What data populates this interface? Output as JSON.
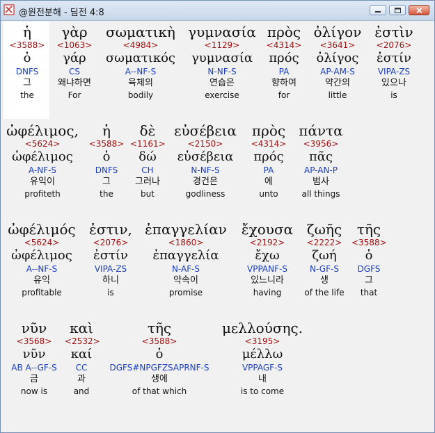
{
  "window": {
    "title": "@원전분해 - 딤전 4:8"
  },
  "colors": {
    "strongs": "#a01010",
    "parsing": "#1a3ebf",
    "text": "#111111"
  },
  "icons": {
    "app": "app-icon",
    "minimize": "minimize-icon",
    "maximize": "maximize-icon",
    "close": "close-icon"
  },
  "rows": [
    {
      "words": [
        {
          "greek": "ἡ",
          "strongs": "<3588>",
          "lemma": "ὁ",
          "parse": "DNFS",
          "korean": "그",
          "english": "the"
        },
        {
          "greek": "γὰρ",
          "strongs": "<1063>",
          "lemma": "γάρ",
          "parse": "CS",
          "korean": "왜냐하면",
          "english": "For"
        },
        {
          "greek": "σωματικὴ",
          "strongs": "<4984>",
          "lemma": "σωματικός",
          "parse": "A--NF-S",
          "korean": "육체의",
          "english": "bodily"
        },
        {
          "greek": "γυμνασία",
          "strongs": "<1129>",
          "lemma": "γυμνασία",
          "parse": "N-NF-S",
          "korean": "연습은",
          "english": "exercise"
        },
        {
          "greek": "πρὸς",
          "strongs": "<4314>",
          "lemma": "πρός",
          "parse": "PA",
          "korean": "향하여",
          "english": "for"
        },
        {
          "greek": "ὀλίγον",
          "strongs": "<3641>",
          "lemma": "ὀλίγος",
          "parse": "AP-AM-S",
          "korean": "약간의",
          "english": "little"
        },
        {
          "greek": "ἐστὶν",
          "strongs": "<2076>",
          "lemma": "ἐστίν",
          "parse": "VIPA-ZS",
          "korean": "있으나",
          "english": "is"
        }
      ]
    },
    {
      "words": [
        {
          "greek": "ὠφέλιμος,",
          "strongs": "<5624>",
          "lemma": "ὠφέλιμος",
          "parse": "A-NF-S",
          "korean": "유익이",
          "english": "profiteth"
        },
        {
          "greek": "ἡ",
          "strongs": "<3588>",
          "lemma": "ὁ",
          "parse": "DNFS",
          "korean": "그",
          "english": "the"
        },
        {
          "greek": "δὲ",
          "strongs": "<1161>",
          "lemma": "δώ",
          "parse": "CH",
          "korean": "그러나",
          "english": "but"
        },
        {
          "greek": "εὐσέβεια",
          "strongs": "<2150>",
          "lemma": "εὐσέβεια",
          "parse": "N-NF-S",
          "korean": "경건은",
          "english": "godliness"
        },
        {
          "greek": "πρὸς",
          "strongs": "<4314>",
          "lemma": "πρός",
          "parse": "PA",
          "korean": "에",
          "english": "unto"
        },
        {
          "greek": "πάντα",
          "strongs": "<3956>",
          "lemma": "πᾶς",
          "parse": "AP-AN-P",
          "korean": "범사",
          "english": "all things"
        }
      ]
    },
    {
      "words": [
        {
          "greek": "ὠφέλιμός",
          "strongs": "<5624>",
          "lemma": "ὠφέλιμος",
          "parse": "A--NF-S",
          "korean": "유익",
          "english": "profitable"
        },
        {
          "greek": "ἐστιν,",
          "strongs": "<2076>",
          "lemma": "ἐστίν",
          "parse": "VIPA-ZS",
          "korean": "하니",
          "english": "is"
        },
        {
          "greek": "ἐπαγγελίαν",
          "strongs": "<1860>",
          "lemma": "ἐπαγγελία",
          "parse": "N-AF-S",
          "korean": "약속이",
          "english": "promise"
        },
        {
          "greek": "ἔχουσα",
          "strongs": "<2192>",
          "lemma": "ἔχω",
          "parse": "VPPANF-S",
          "korean": "있느니라",
          "english": "having"
        },
        {
          "greek": "ζωῆς",
          "strongs": "<2222>",
          "lemma": "ζωή",
          "parse": "N-GF-S",
          "korean": "생",
          "english": "of the life"
        },
        {
          "greek": "τῆς",
          "strongs": "<3588>",
          "lemma": "ὁ",
          "parse": "DGFS",
          "korean": "그",
          "english": "that"
        }
      ]
    },
    {
      "words": [
        {
          "greek": "νῦν",
          "strongs": "<3568>",
          "lemma": "νῦν",
          "parse": "AB A--GF-S",
          "korean": "금",
          "english": "now is"
        },
        {
          "greek": "καὶ",
          "strongs": "<2532>",
          "lemma": "καί",
          "parse": "CC",
          "korean": "과",
          "english": "and"
        },
        {
          "greek": "τῆς",
          "strongs": "<3588>",
          "lemma": "ὁ",
          "parse": "DGFS#NPGFZSAPRNF-S",
          "korean": "생에",
          "english": "of that which"
        },
        {
          "greek": "μελλούσης.",
          "strongs": "<3195>",
          "lemma": "μέλλω",
          "parse": "VPPAGF-S",
          "korean": "내",
          "english": "is to come"
        }
      ]
    }
  ]
}
